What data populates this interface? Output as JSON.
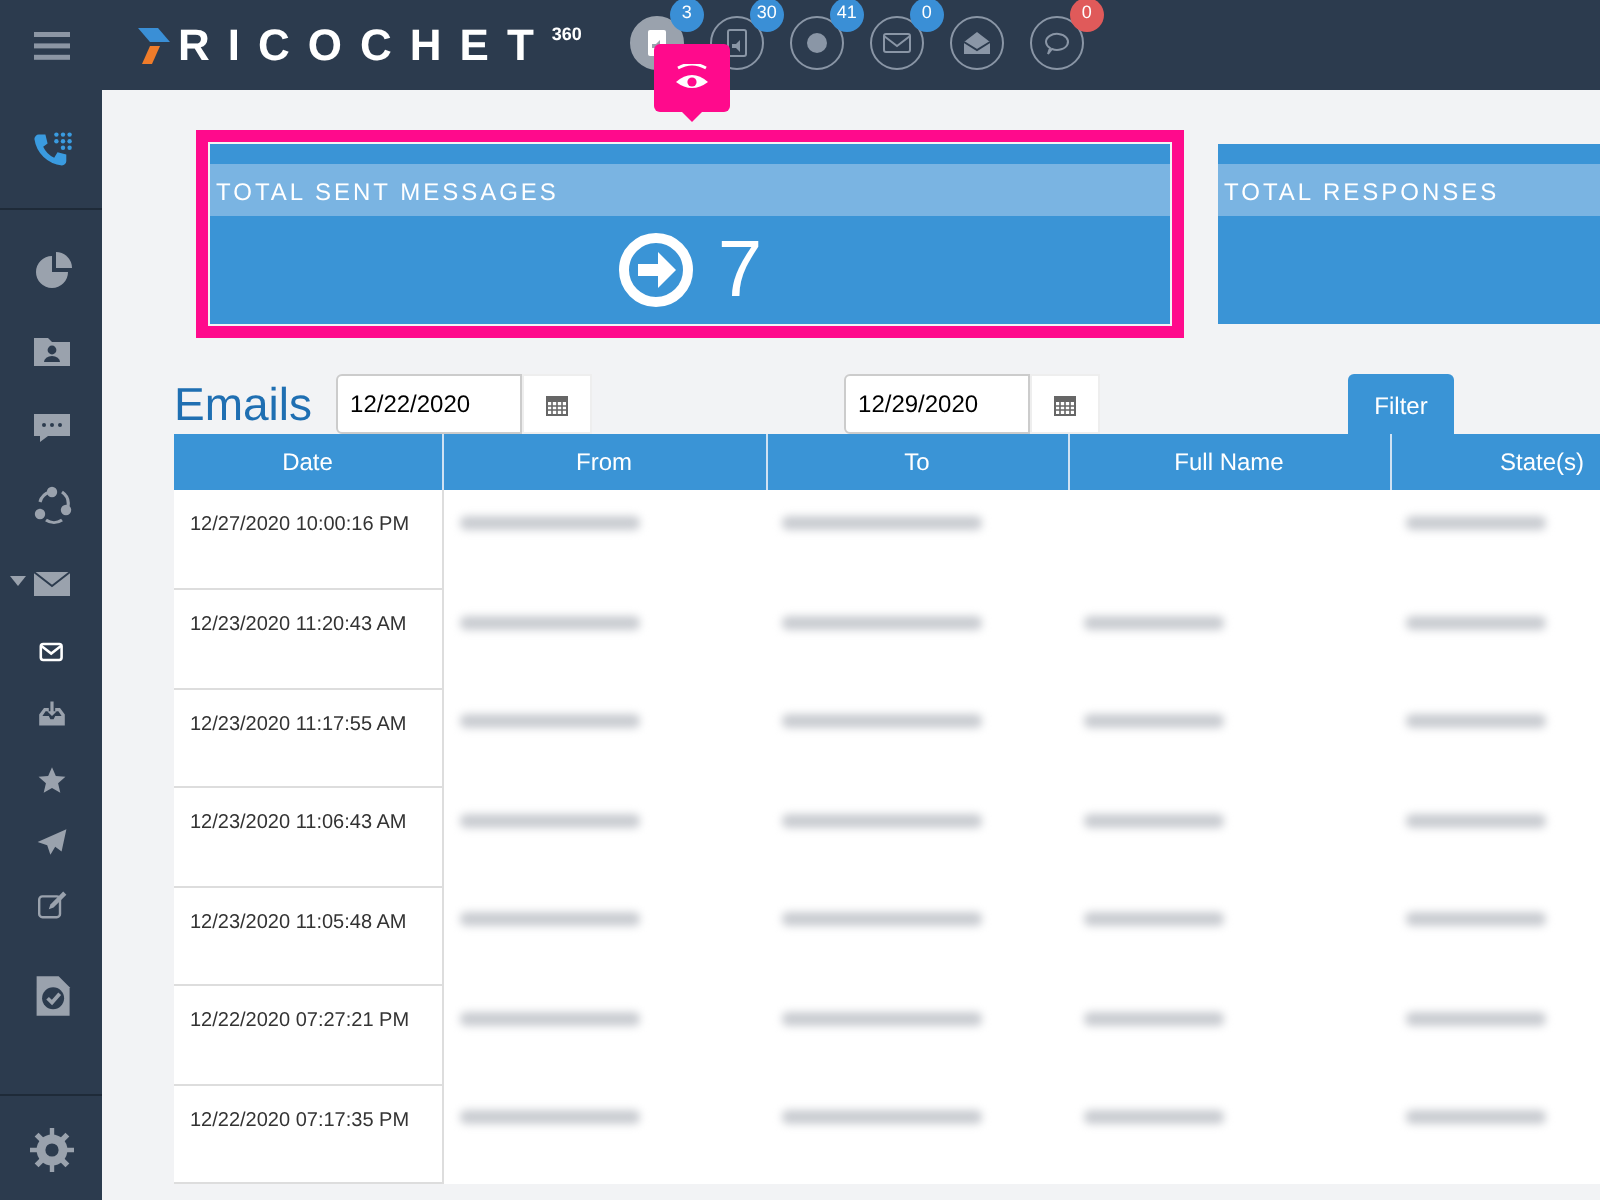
{
  "header": {
    "brand": "RICOCHET",
    "brand_sup": "360",
    "counters": [
      {
        "badge": "3",
        "color": "#3a8fd6",
        "selected": true
      },
      {
        "badge": "30",
        "color": "#3a8fd6",
        "selected": false
      },
      {
        "badge": "41",
        "color": "#3a8fd6",
        "selected": false
      },
      {
        "badge": "0",
        "color": "#3a8fd6",
        "selected": false
      },
      {
        "selected": false
      },
      {
        "badge": "0",
        "color": "#e05a5a",
        "selected": false
      }
    ]
  },
  "sidebar": {
    "items": [
      {
        "kind": "dialer",
        "selected": true
      },
      {
        "kind": "chart",
        "selected": false
      },
      {
        "kind": "contacts",
        "selected": false
      },
      {
        "kind": "chat",
        "selected": false
      },
      {
        "kind": "share",
        "selected": false
      },
      {
        "kind": "mail",
        "selected": false,
        "expanded": true
      },
      {
        "kind": "inbox",
        "selected": true
      },
      {
        "kind": "download",
        "selected": false
      },
      {
        "kind": "star",
        "selected": false
      },
      {
        "kind": "send",
        "selected": false
      },
      {
        "kind": "edit",
        "selected": false
      },
      {
        "kind": "task",
        "selected": false
      },
      {
        "kind": "gear",
        "selected": false
      }
    ]
  },
  "stats": [
    {
      "title": "TOTAL SENT MESSAGES",
      "value": "7",
      "highlighted": true
    },
    {
      "title": "TOTAL RESPONSES",
      "highlighted": false
    }
  ],
  "emails": {
    "title": "Emails",
    "from_date": "12/22/2020",
    "to_date": "12/29/2020",
    "filter_button": "Filter",
    "columns": [
      "Date",
      "From",
      "To",
      "Full Name",
      "State(s)"
    ],
    "rows": [
      {
        "date": "12/27/2020 10:00:16 PM",
        "blurred": [
          true,
          true,
          false,
          true
        ]
      },
      {
        "date": "12/23/2020 11:20:43 AM",
        "blurred": [
          true,
          true,
          true,
          true
        ]
      },
      {
        "date": "12/23/2020 11:17:55 AM",
        "blurred": [
          true,
          true,
          true,
          true
        ]
      },
      {
        "date": "12/23/2020 11:06:43 AM",
        "blurred": [
          true,
          true,
          true,
          true
        ]
      },
      {
        "date": "12/23/2020 11:05:48 AM",
        "blurred": [
          true,
          true,
          true,
          true
        ]
      },
      {
        "date": "12/22/2020 07:27:21 PM",
        "blurred": [
          true,
          true,
          true,
          true
        ]
      },
      {
        "date": "12/22/2020 07:17:35 PM",
        "blurred": [
          true,
          true,
          true,
          true
        ]
      }
    ]
  }
}
